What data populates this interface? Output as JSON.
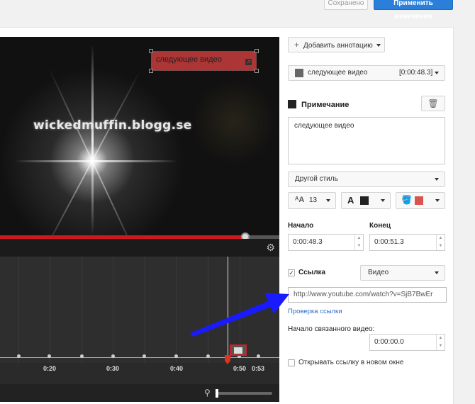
{
  "top": {
    "saved_label": "Сохранено",
    "apply_label": "Применить изменения"
  },
  "player": {
    "watermark": "wickedmuffin.blogg.se",
    "annotation_text": "следующее видео"
  },
  "timeline": {
    "ticks": [
      "0:20",
      "0:30",
      "0:40",
      "0:50",
      "0:53"
    ]
  },
  "panel": {
    "add_annotation_label": "Добавить аннотацию",
    "annotation_item_name": "следующее видео",
    "annotation_item_time": "[0:00:48.3]",
    "note_label": "Примечание",
    "note_text": "следующее видео",
    "style_label": "Другой стиль",
    "font_size": "13",
    "text_color": "#222222",
    "bg_color": "#d9534f",
    "start_label": "Начало",
    "start_value": "0:00:48.3",
    "end_label": "Конец",
    "end_value": "0:00:51.3",
    "link_checkbox_label": "Ссылка",
    "link_checked": true,
    "link_type": "Видео",
    "link_url": "http://www.youtube.com/watch?v=SjB7BwEr",
    "check_link_label": "Проверка ссылки",
    "linked_start_label": "Начало связанного видео:",
    "linked_start_value": "0:00:00.0",
    "new_window_label": "Открывать ссылку в новом окне",
    "new_window_checked": false
  },
  "colors": {
    "accent": "#2b7fd8",
    "progress": "#cc181e",
    "pointer_arrow": "#1a1aff"
  }
}
